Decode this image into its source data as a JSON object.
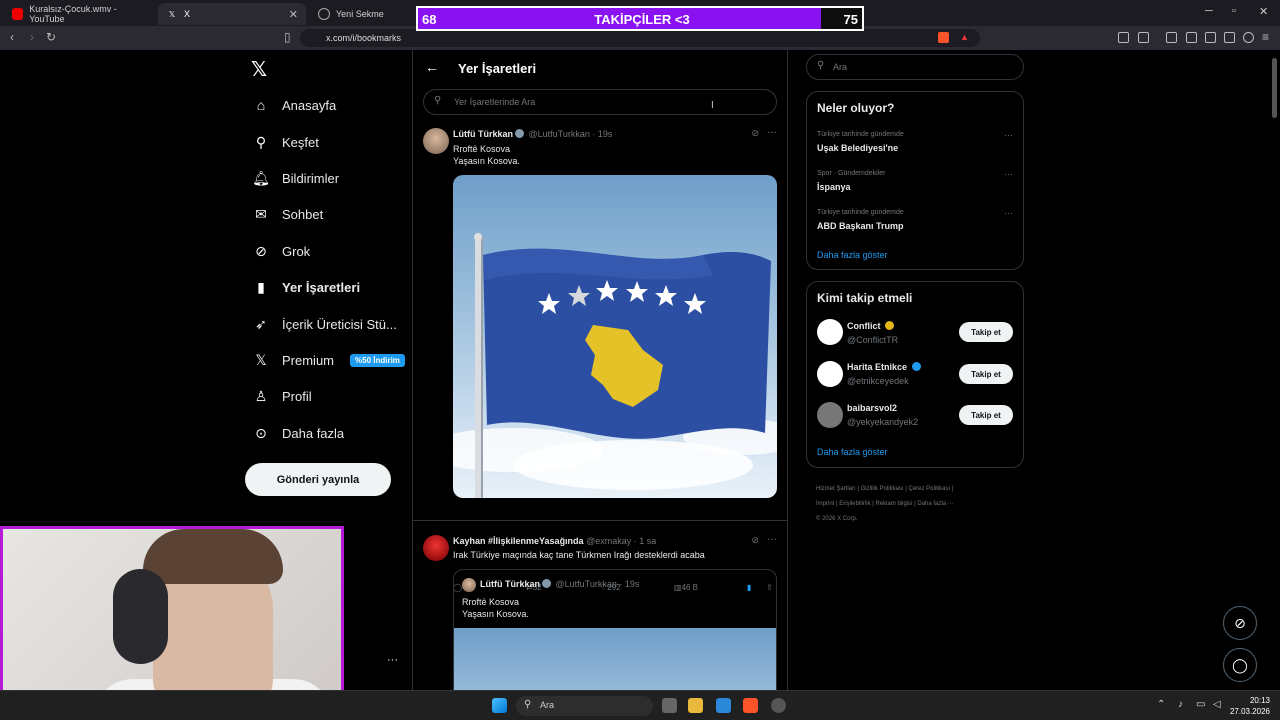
{
  "browser": {
    "tabs": [
      {
        "label": "Kuralsız-Çocuk.wmv - YouTube",
        "active": false
      },
      {
        "label": "X",
        "active": true
      },
      {
        "label": "Yeni Sekme",
        "active": false
      }
    ],
    "url": "x.com/i/bookmarks"
  },
  "overlay": {
    "current": "68",
    "label": "TAKİPÇİLER <3",
    "goal": "75",
    "progress": 0.907
  },
  "sidebar": {
    "items": [
      {
        "label": "Anasayfa",
        "icon": "home-icon"
      },
      {
        "label": "Keşfet",
        "icon": "search-icon"
      },
      {
        "label": "Bildirimler",
        "icon": "bell-icon"
      },
      {
        "label": "Sohbet",
        "icon": "mail-icon"
      },
      {
        "label": "Grok",
        "icon": "grok-icon"
      },
      {
        "label": "Yer İşaretleri",
        "icon": "bookmark-icon"
      },
      {
        "label": "İçerik Üreticisi Stü...",
        "icon": "rocket-icon"
      },
      {
        "label": "Premium",
        "icon": "x-logo-icon"
      },
      {
        "label": "Profil",
        "icon": "person-icon"
      },
      {
        "label": "Daha fazla",
        "icon": "more-circle-icon"
      }
    ],
    "premium_badge": "%50 İndirim",
    "post_button": "Gönderi yayınla"
  },
  "main": {
    "title": "Yer İşaretleri",
    "search_placeholder": "Yer İşaretlerinde Ara",
    "tweets": [
      {
        "name": "Lütfü Türkkan",
        "handle": "@LutfuTurkkan",
        "time": "· 19s",
        "line1": "Rroftë Kosova",
        "line2": "Yaşasın Kosova.",
        "replies": "42",
        "retweets": "32",
        "likes": "292",
        "views": "46 B"
      },
      {
        "name": "Kayhan #İlişkilenmeYasağında",
        "handle": "@exmakay",
        "time": "· 1 sa",
        "text": "Irak Türkiye maçında kaç tane Türkmen Irağı desteklerdi acaba",
        "quote": {
          "name": "Lütfü Türkkan",
          "handle": "@LutfuTurkkan",
          "time": "· 19s",
          "line1": "Rroftë Kosova",
          "line2": "Yaşasın Kosova."
        }
      }
    ]
  },
  "right": {
    "search_placeholder": "Ara",
    "trends_title": "Neler oluyor?",
    "trends": [
      {
        "context": "Türkiye tarihinde gündemde",
        "name": "Uşak Belediyesi'ne"
      },
      {
        "context": "Spor · Gündemdekiler",
        "name": "İspanya"
      },
      {
        "context": "Türkiye tarihinde gündemde",
        "name": "ABD Başkanı Trump"
      }
    ],
    "trends_more": "Daha fazla göster",
    "who_title": "Kimi takip etmeli",
    "who": [
      {
        "name": "Conflict",
        "handle": "@ConflictTR",
        "button": "Takip et"
      },
      {
        "name": "Harita Etnikce",
        "handle": "@etnikceyedek",
        "button": "Takip et"
      },
      {
        "name": "baibarsvol2",
        "handle": "@yekyekandyek2",
        "button": "Takip et"
      }
    ],
    "who_more": "Daha fazla göster",
    "footer_line1": "Hizmet Şartları  |  Gizlilik Politikası  |  Çerez Politikası  |",
    "footer_line2": "İmprint  |  Erişilebilirlik  |  Reklam bilgisi  |  Daha fazla ···",
    "footer_line3": "© 2026 X Corp."
  },
  "taskbar": {
    "search": "Ara",
    "time": "20:13",
    "date": "27.03.2026"
  },
  "colors": {
    "accent": "#1d9bf0",
    "overlay_fill": "#8a12f0",
    "webcam_border": "#b51bd6"
  }
}
